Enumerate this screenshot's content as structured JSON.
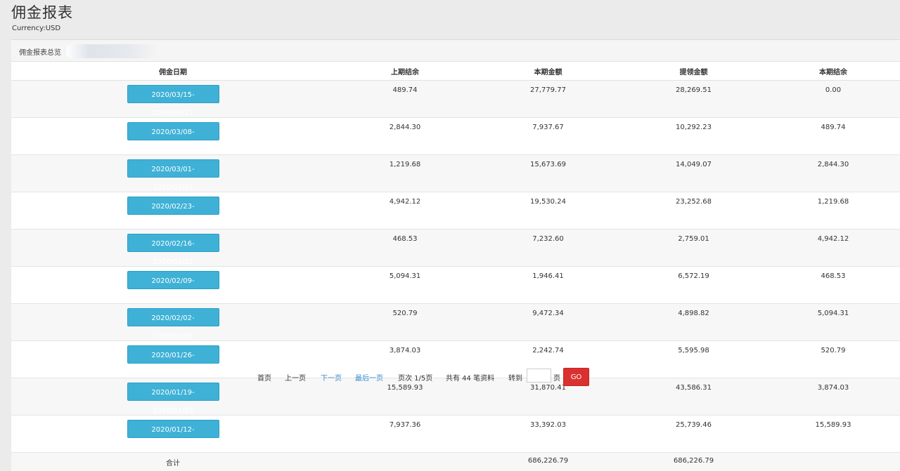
{
  "page": {
    "title": "佣金报表",
    "currency": "Currency:USD",
    "panel_label": "佣金报表总览"
  },
  "table": {
    "headers": [
      "佣金日期",
      "上期结余",
      "本期金额",
      "提领金额",
      "本期结余"
    ],
    "rows": [
      {
        "date": "2020/03/15-2020/03/21",
        "prev": "489.74",
        "current": "27,779.77",
        "withdraw": "28,269.51",
        "balance": "0.00"
      },
      {
        "date": "2020/03/08-2020/03/14",
        "prev": "2,844.30",
        "current": "7,937.67",
        "withdraw": "10,292.23",
        "balance": "489.74"
      },
      {
        "date": "2020/03/01-2020/03/07",
        "prev": "1,219.68",
        "current": "15,673.69",
        "withdraw": "14,049.07",
        "balance": "2,844.30"
      },
      {
        "date": "2020/02/23-2020/02/29",
        "prev": "4,942.12",
        "current": "19,530.24",
        "withdraw": "23,252.68",
        "balance": "1,219.68"
      },
      {
        "date": "2020/02/16-2020/02/22",
        "prev": "468.53",
        "current": "7,232.60",
        "withdraw": "2,759.01",
        "balance": "4,942.12"
      },
      {
        "date": "2020/02/09-2020/02/15",
        "prev": "5,094.31",
        "current": "1,946.41",
        "withdraw": "6,572.19",
        "balance": "468.53"
      },
      {
        "date": "2020/02/02-2020/02/08",
        "prev": "520.79",
        "current": "9,472.34",
        "withdraw": "4,898.82",
        "balance": "5,094.31"
      },
      {
        "date": "2020/01/26-2020/02/01",
        "prev": "3,874.03",
        "current": "2,242.74",
        "withdraw": "5,595.98",
        "balance": "520.79"
      },
      {
        "date": "2020/01/19-2020/01/25",
        "prev": "15,589.93",
        "current": "31,870.41",
        "withdraw": "43,586.31",
        "balance": "3,874.03"
      },
      {
        "date": "2020/01/12-2020/01/18",
        "prev": "7,937.36",
        "current": "33,392.03",
        "withdraw": "25,739.46",
        "balance": "15,589.93"
      }
    ],
    "total": {
      "label": "合计",
      "current": "686,226.79",
      "withdraw": "686,226.79"
    }
  },
  "pager": {
    "first": "首页",
    "prev": "上一页",
    "next": "下一页",
    "last": "最后一页",
    "page_info": "页次 1/5页",
    "count_info": "共有 44 笔资料",
    "goto_label": "转到",
    "goto_value": "",
    "page_suffix": "页",
    "go_label": "GO"
  },
  "colors": {
    "date_button": "#3fb1d6",
    "go_button": "#d9312f",
    "link": "#3a8dcc"
  }
}
